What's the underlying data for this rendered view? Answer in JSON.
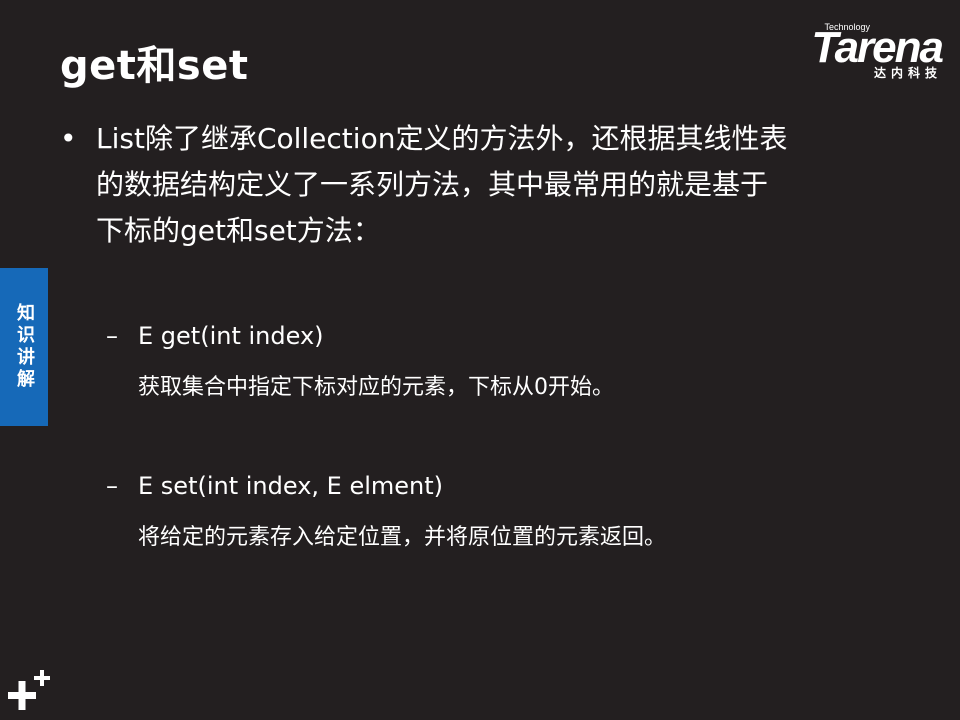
{
  "slide": {
    "title": "get和set",
    "logo": {
      "tagline": "Technology",
      "wordmark": "Tarena",
      "chinese_name": "达内科技"
    },
    "side_tab_label": "知识讲解",
    "bullet": {
      "line1": "List除了继承Collection定义的方法外，还根据其线性表",
      "line2": "的数据结构定义了一系列方法，其中最常用的就是基于",
      "line3": "下标的get和set方法："
    },
    "methods": [
      {
        "dash": "–",
        "signature": "E get(int index)",
        "description": "获取集合中指定下标对应的元素，下标从0开始。"
      },
      {
        "dash": "–",
        "signature": "E set(int index, E elment)",
        "description": "将给定的元素存入给定位置，并将原位置的元素返回。"
      }
    ],
    "bullet_symbol": "•",
    "colors": {
      "background": "#231f20",
      "side_tab": "#1669b8",
      "text": "#ffffff"
    },
    "icons": {
      "corner": "plus-plus-icon"
    }
  }
}
